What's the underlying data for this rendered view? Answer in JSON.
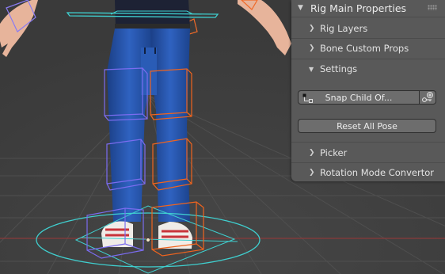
{
  "panel": {
    "title": "Rig Main Properties",
    "sections": [
      {
        "label": "Rig Layers",
        "expanded": false
      },
      {
        "label": "Bone Custom Props",
        "expanded": false
      },
      {
        "label": "Settings",
        "expanded": true
      }
    ],
    "settings": {
      "snap_button": "Snap Child Of...",
      "reset_button": "Reset All Pose"
    },
    "lower_sections": [
      {
        "label": "Picker",
        "expanded": false
      },
      {
        "label": "Rotation Mode Convertor",
        "expanded": false
      }
    ]
  },
  "colors": {
    "panel_bg": "#595959",
    "viewport_bg": "#3f3f3f",
    "bone_blue": "#7b6cf0",
    "bone_orange": "#f0641e",
    "bone_cyan": "#3fd0d0",
    "jeans": "#2553a8"
  }
}
